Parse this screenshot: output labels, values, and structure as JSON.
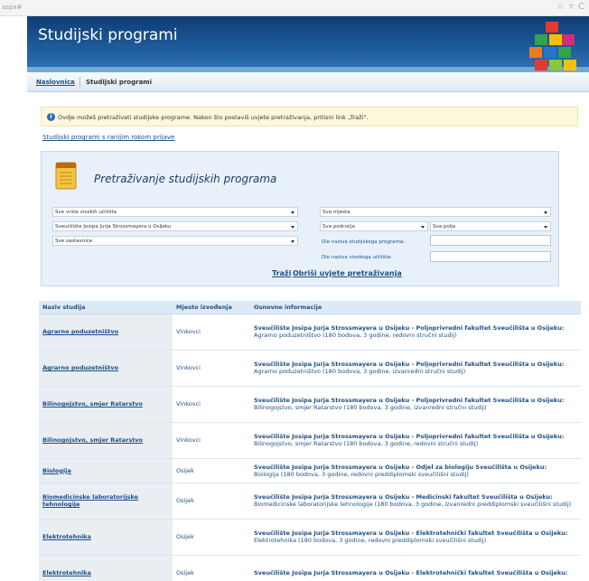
{
  "browser": {
    "url_fragment": "aspx#",
    "toolbar_glyphs": "☆ ▿ C"
  },
  "header": {
    "title": "Studijski programi"
  },
  "nav": {
    "home": "Naslovnica",
    "current": "Studijski programi"
  },
  "note": {
    "text": "Ovdje možeš pretraživati studijske programe. Nakon što postaviš uvjete pretraživanja, pritisni link „Traži\"."
  },
  "early_link": "Studijski programi s ranijim rokom prijave",
  "search": {
    "title": "Pretraživanje studijskih programa",
    "school_type": "Sve vrste visokih učilišta",
    "university": "Sveučilište Josipa Jurja Strossmayera u Osijeku",
    "component": "Sve sastavnice",
    "place": "Sva mjesta",
    "area": "Sva područja",
    "field": "Sva polja",
    "program_name_label": "Dio naziva studijskoga programa:",
    "school_name_label": "Dio naziva visokoga učilišta:",
    "search_link": "Traži",
    "clear_link": "Obriši uvjete pretraživanja"
  },
  "table": {
    "headers": [
      "Naziv studija",
      "Mjesto izvođenja",
      "Osnovne informacije"
    ],
    "rows": [
      {
        "name": "Agrarno poduzetništvo",
        "place": "Vinkovci",
        "institution": "Sveučilište Josipa Jurja Strossmayera u Osijeku - Poljoprivredni fakultet Sveučilišta u Osijeku:",
        "details": "Agrarno poduzetništvo (180 bodova, 3 godine, redovni stručni studij)"
      },
      {
        "name": "Agrarno poduzetništvo",
        "place": "Vinkovci",
        "institution": "Sveučilište Josipa Jurja Strossmayera u Osijeku - Poljoprivredni fakultet Sveučilišta u Osijeku:",
        "details": "Agrarno poduzetništvo (180 bodova, 3 godine, izvanredni stručni studij)"
      },
      {
        "name": "Bilinogojstvo, smjer Ratarstvo",
        "place": "Vinkovci",
        "institution": "Sveučilište Josipa Jurja Strossmayera u Osijeku - Poljoprivredni fakultet Sveučilišta u Osijeku:",
        "details": "Bilinogojstvo, smjer Ratarstvo (180 bodova, 3 godine, izvanredni stručni studij)"
      },
      {
        "name": "Bilinogojstvo, smjer Ratarstvo",
        "place": "Vinkovci",
        "institution": "Sveučilište Josipa Jurja Strossmayera u Osijeku - Poljoprivredni fakultet Sveučilišta u Osijeku:",
        "details": "Bilinogojstvo, smjer Ratarstvo (180 bodova, 3 godine, redovni stručni studij)"
      },
      {
        "name": "Biologija",
        "place": "Osijek",
        "institution": "Sveučilište Josipa Jurja Strossmayera u Osijeku - Odjel za biologiju Sveučilišta u Osijeku:",
        "details": "Biologija (180 bodova, 3 godine, redovni preddiplomski sveučilišni studij)"
      },
      {
        "name": "Biomedicinske laboratorijske tehnologije",
        "place": "Osijek",
        "institution": "Sveučilište Josipa Jurja Strossmayera u Osijeku - Medicinski fakultet Sveučilišta u Osijeku:",
        "details": "Biomedicinske laboratorijske tehnologije (180 bodova, 3 godine, izvanredni preddiplomski sveučilišni studij)"
      },
      {
        "name": "Elektrotehnika",
        "place": "Osijek",
        "institution": "Sveučilište Josipa Jurja Strossmayera u Osijeku - Elektrotehnički fakultet Sveučilišta u Osijeku:",
        "details": "Elektrotehnika (180 bodova, 3 godine, redovni preddiplomski sveučilišni studij)"
      },
      {
        "name": "Elektrotehnika",
        "place": "Osijek",
        "institution": "Sveučilište Josipa Jurja Strossmayera u Osijeku - Elektrotehnički fakultet Sveučilišta u Osijeku:",
        "details": ""
      }
    ]
  }
}
